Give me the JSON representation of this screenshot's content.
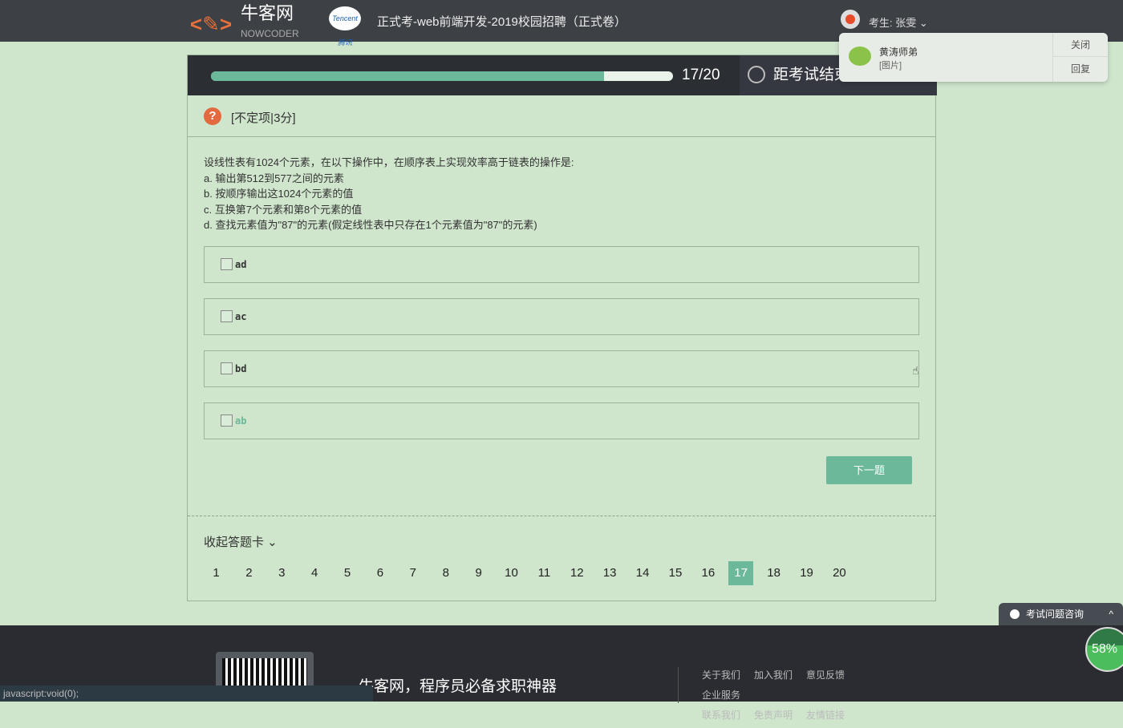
{
  "header": {
    "logo": "牛客网",
    "logo_sub": "NOWCODER",
    "partner": "Tencent 腾讯",
    "exam_title": "正式考-web前端开发-2019校园招聘（正式卷）",
    "user": "考生: 张雯 ⌄"
  },
  "notification": {
    "sender": "黄涛师弟",
    "message": "[图片]",
    "close": "关闭",
    "reply": "回复"
  },
  "progress": {
    "current": 17,
    "total": 20,
    "label": "17/20",
    "fraction": 0.85
  },
  "timer": {
    "label": "距考试结束"
  },
  "question": {
    "type": "[不定项|3分]",
    "lines": [
      "设线性表有1024个元素，在以下操作中，在顺序表上实现效率高于链表的操作是:",
      "a. 输出第512到577之间的元素",
      "b. 按顺序输出这1024个元素的值",
      "c. 互换第7个元素和第8个元素的值",
      "d. 查找元素值为\"87\"的元素(假定线性表中只存在1个元素值为\"87\"的元素)"
    ],
    "options": [
      "ad",
      "ac",
      "bd",
      "ab"
    ]
  },
  "next_button": "下一题",
  "answer_card": {
    "toggle": "收起答题卡 ⌄",
    "numbers": [
      "1",
      "2",
      "3",
      "4",
      "5",
      "6",
      "7",
      "8",
      "9",
      "10",
      "11",
      "12",
      "13",
      "14",
      "15",
      "16",
      "17",
      "18",
      "19",
      "20"
    ],
    "current": "17"
  },
  "footer": {
    "slogan": "牛客网，程序员必备求职神器",
    "links": [
      "关于我们",
      "加入我们",
      "意见反馈",
      "企业服务",
      "联系我们",
      "免责声明",
      "友情链接"
    ]
  },
  "status_bar": "javascript:void(0);",
  "consult": {
    "label": "考试问题咨询",
    "caret": "^"
  },
  "speed_ball": "58%"
}
